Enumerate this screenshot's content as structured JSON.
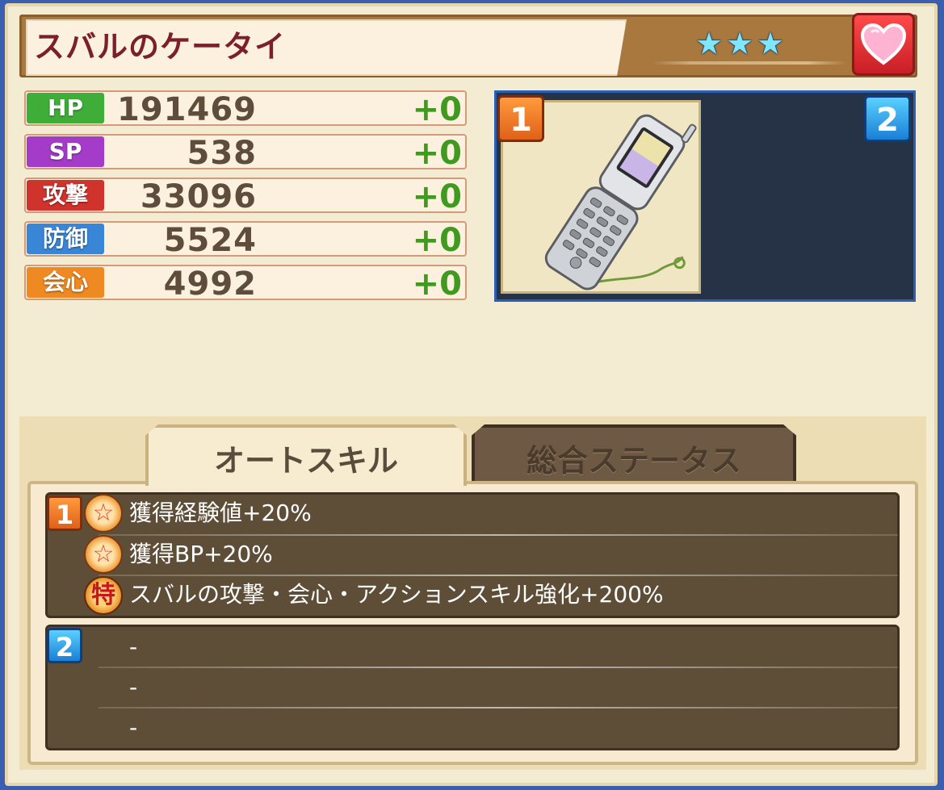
{
  "item": {
    "name": "スバルのケータイ",
    "stars": [
      "★",
      "★",
      "★"
    ],
    "favorite_icon": "heart-icon"
  },
  "stats": [
    {
      "label": "HP",
      "value": "191469",
      "bonus": "+0",
      "color": "#3fae38"
    },
    {
      "label": "SP",
      "value": "538",
      "bonus": "+0",
      "color": "#a43bc9"
    },
    {
      "label": "攻撃",
      "value": "33096",
      "bonus": "+0",
      "color": "#d0322c"
    },
    {
      "label": "防御",
      "value": "5524",
      "bonus": "+0",
      "color": "#3a86d6"
    },
    {
      "label": "会心",
      "value": "4992",
      "bonus": "+0",
      "color": "#ef8a23"
    }
  ],
  "slots": {
    "slot1_number": "1",
    "slot2_number": "2",
    "slot1_item_icon": "flip-phone-icon"
  },
  "tabs": {
    "auto_skill": "オートスキル",
    "total_status": "総合ステータス"
  },
  "skills": {
    "group1_number": "1",
    "group1": [
      {
        "badge": "☆",
        "badge_icon": "star-medal-icon",
        "text": "獲得経験値+20%"
      },
      {
        "badge": "☆",
        "badge_icon": "star-medal-icon",
        "text": "獲得BP+20%"
      },
      {
        "badge": "特",
        "badge_icon": "special-medal-icon",
        "text": "スバルの攻撃・会心・アクションスキル強化+200%"
      }
    ],
    "group2_number": "2",
    "group2": [
      "-",
      "-",
      "-"
    ]
  }
}
